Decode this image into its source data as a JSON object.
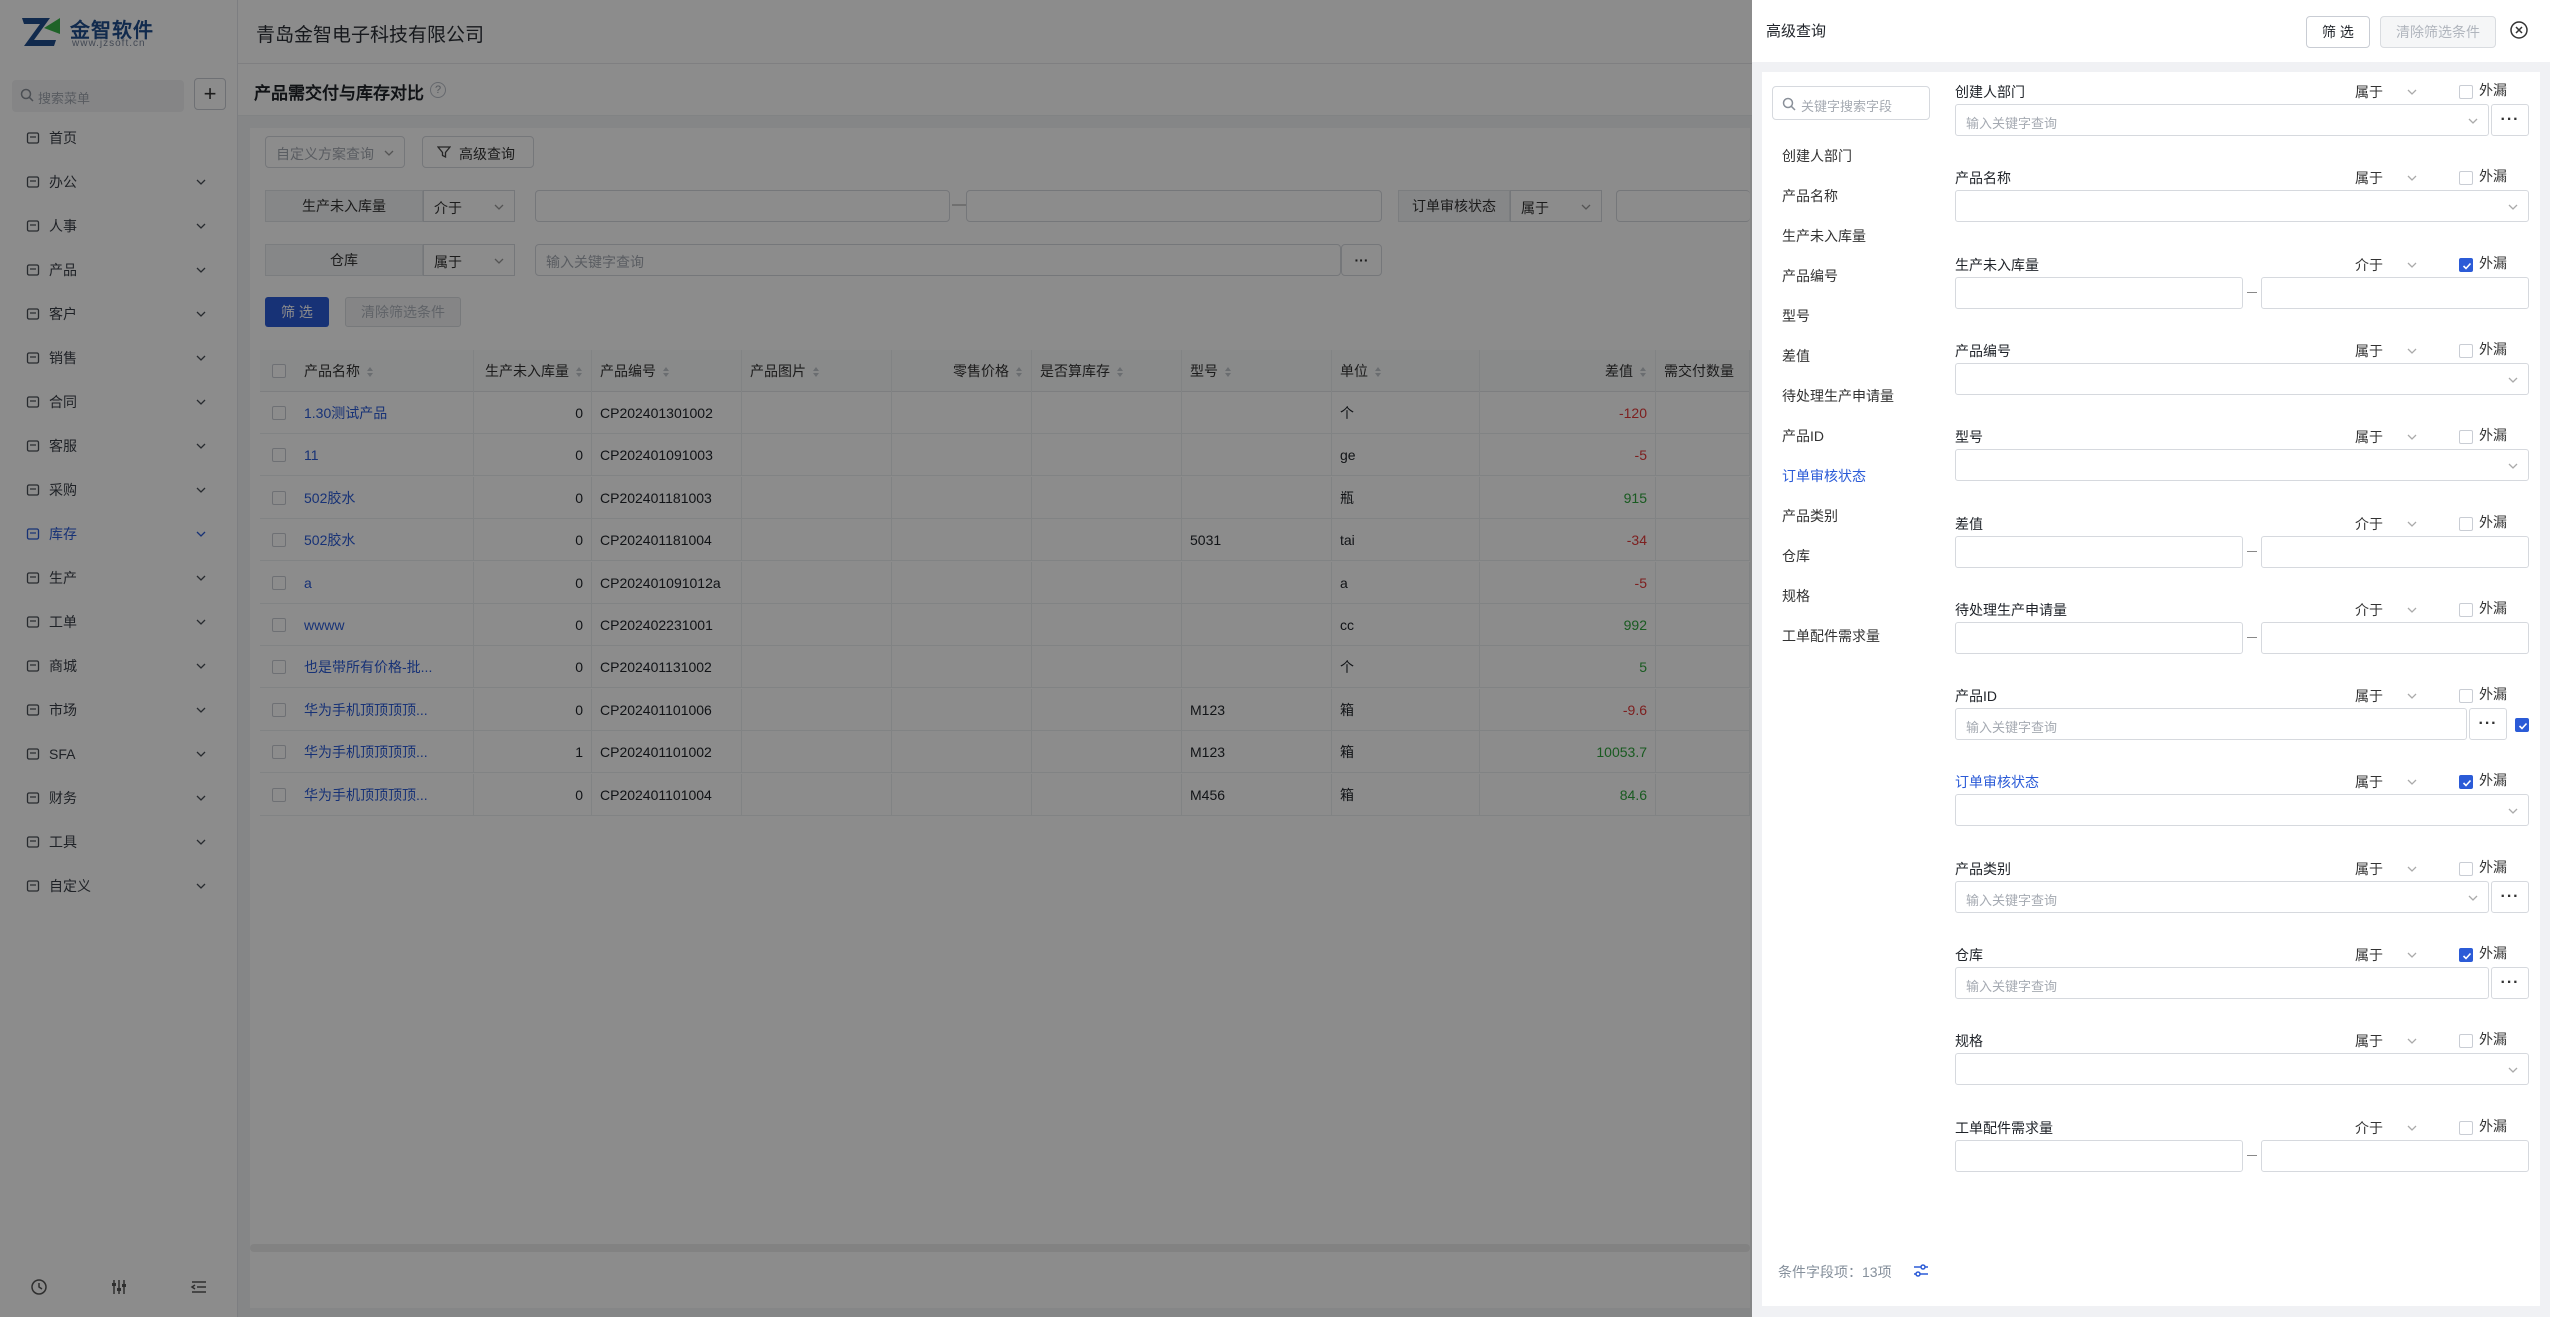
{
  "app": {
    "logo_name": "金智软件",
    "logo_url": "www.jzsoft.cn",
    "company": "青岛金智电子科技有限公司",
    "menu_search_placeholder": "搜索菜单"
  },
  "sidebar": {
    "items": [
      {
        "label": "首页",
        "icon": "home-icon",
        "expandable": false
      },
      {
        "label": "办公",
        "icon": "office-icon",
        "expandable": true
      },
      {
        "label": "人事",
        "icon": "people-icon",
        "expandable": true
      },
      {
        "label": "产品",
        "icon": "box-icon",
        "expandable": true
      },
      {
        "label": "客户",
        "icon": "chart-icon",
        "expandable": true
      },
      {
        "label": "销售",
        "icon": "target-icon",
        "expandable": true
      },
      {
        "label": "合同",
        "icon": "contract-icon",
        "expandable": true
      },
      {
        "label": "客服",
        "icon": "headset-icon",
        "expandable": true
      },
      {
        "label": "采购",
        "icon": "bag-icon",
        "expandable": true
      },
      {
        "label": "库存",
        "icon": "warehouse-icon",
        "expandable": true,
        "active": true
      },
      {
        "label": "生产",
        "icon": "factory-icon",
        "expandable": true
      },
      {
        "label": "工单",
        "icon": "ticket-icon",
        "expandable": true
      },
      {
        "label": "商城",
        "icon": "shop-icon",
        "expandable": true
      },
      {
        "label": "市场",
        "icon": "calendar-icon",
        "expandable": true
      },
      {
        "label": "SFA",
        "icon": "sfa-icon",
        "expandable": true
      },
      {
        "label": "财务",
        "icon": "bank-icon",
        "expandable": true
      },
      {
        "label": "工具",
        "icon": "toolbox-icon",
        "expandable": true
      },
      {
        "label": "自定义",
        "icon": "grid-icon",
        "expandable": true
      }
    ]
  },
  "page": {
    "title": "产品需交付与库存对比",
    "help": "?"
  },
  "filters": {
    "scheme_placeholder": "自定义方案查询",
    "advanced_label": "高级查询",
    "row1": {
      "label": "生产未入库量",
      "op": "介于",
      "label2": "订单审核状态",
      "op2": "属于"
    },
    "row2": {
      "label": "仓库",
      "op": "属于",
      "placeholder": "输入关键字查询"
    },
    "filter_btn": "筛 选",
    "clear_btn": "清除筛选条件",
    "range_sep": "—",
    "more_btn": "···"
  },
  "table": {
    "headers": [
      "产品名称",
      "生产未入库量",
      "产品编号",
      "产品图片",
      "零售价格",
      "是否算库存",
      "型号",
      "单位",
      "差值",
      "需交付数量"
    ],
    "rows": [
      {
        "name": "1.30测试产品",
        "qty": "0",
        "code": "CP202401301002",
        "img": "",
        "price": "",
        "stock": "",
        "model": "",
        "unit": "个",
        "diff": "-120"
      },
      {
        "name": "11",
        "qty": "0",
        "code": "CP202401091003",
        "img": "",
        "price": "",
        "stock": "",
        "model": "",
        "unit": "ge",
        "diff": "-5"
      },
      {
        "name": "502胶水",
        "qty": "0",
        "code": "CP202401181003",
        "img": "",
        "price": "",
        "stock": "",
        "model": "",
        "unit": "瓶",
        "diff": "915"
      },
      {
        "name": "502胶水",
        "qty": "0",
        "code": "CP202401181004",
        "img": "",
        "price": "",
        "stock": "",
        "model": "5031",
        "unit": "tai",
        "diff": "-34"
      },
      {
        "name": "a",
        "qty": "0",
        "code": "CP202401091012a",
        "img": "",
        "price": "",
        "stock": "",
        "model": "",
        "unit": "a",
        "diff": "-5"
      },
      {
        "name": "wwww",
        "qty": "0",
        "code": "CP202402231001",
        "img": "",
        "price": "",
        "stock": "",
        "model": "",
        "unit": "cc",
        "diff": "992"
      },
      {
        "name": "也是带所有价格-批...",
        "qty": "0",
        "code": "CP202401131002",
        "img": "",
        "price": "",
        "stock": "",
        "model": "",
        "unit": "个",
        "diff": "5"
      },
      {
        "name": "华为手机顶顶顶顶...",
        "qty": "0",
        "code": "CP202401101006",
        "img": "",
        "price": "",
        "stock": "",
        "model": "M123",
        "unit": "箱",
        "diff": "-9.6"
      },
      {
        "name": "华为手机顶顶顶顶...",
        "qty": "1",
        "code": "CP202401101002",
        "img": "",
        "price": "",
        "stock": "",
        "model": "M123",
        "unit": "箱",
        "diff": "10053.7"
      },
      {
        "name": "华为手机顶顶顶顶...",
        "qty": "0",
        "code": "CP202401101004",
        "img": "",
        "price": "",
        "stock": "",
        "model": "M456",
        "unit": "箱",
        "diff": "84.6"
      }
    ]
  },
  "drawer": {
    "title": "高级查询",
    "filter_btn": "筛 选",
    "clear_btn": "清除筛选条件",
    "field_search_placeholder": "关键字搜索字段",
    "field_list": [
      "创建人部门",
      "产品名称",
      "生产未入库量",
      "产品编号",
      "型号",
      "差值",
      "待处理生产申请量",
      "产品ID",
      "订单审核状态",
      "产品类别",
      "仓库",
      "规格",
      "工单配件需求量"
    ],
    "active_field": "订单审核状态",
    "count_text": "条件字段项：13项",
    "leak_label": "外漏",
    "fields": [
      {
        "label": "创建人部门",
        "op": "属于",
        "input": "select-dots",
        "placeholder": "输入关键字查询",
        "leak": false
      },
      {
        "label": "产品名称",
        "op": "属于",
        "input": "select",
        "placeholder": "",
        "leak": false
      },
      {
        "label": "生产未入库量",
        "op": "介于",
        "input": "range",
        "placeholder": "",
        "leak": true
      },
      {
        "label": "产品编号",
        "op": "属于",
        "input": "select",
        "placeholder": "",
        "leak": false
      },
      {
        "label": "型号",
        "op": "属于",
        "input": "select",
        "placeholder": "",
        "leak": false
      },
      {
        "label": "差值",
        "op": "介于",
        "input": "range",
        "placeholder": "",
        "leak": false
      },
      {
        "label": "待处理生产申请量",
        "op": "介于",
        "input": "range",
        "placeholder": "",
        "leak": false
      },
      {
        "label": "产品ID",
        "op": "属于",
        "input": "text-dots-check",
        "placeholder": "输入关键字查询",
        "leak": false
      },
      {
        "label": "订单审核状态",
        "op": "属于",
        "input": "select",
        "placeholder": "",
        "leak": true,
        "highlight": true
      },
      {
        "label": "产品类别",
        "op": "属于",
        "input": "select-dots",
        "placeholder": "输入关键字查询",
        "leak": false
      },
      {
        "label": "仓库",
        "op": "属于",
        "input": "text-dots",
        "placeholder": "输入关键字查询",
        "leak": true
      },
      {
        "label": "规格",
        "op": "属于",
        "input": "select",
        "placeholder": "",
        "leak": false
      },
      {
        "label": "工单配件需求量",
        "op": "介于",
        "input": "range",
        "placeholder": "",
        "leak": false
      }
    ]
  },
  "colors": {
    "primary": "#2b5bd7",
    "negative": "#e33a3a",
    "positive": "#2fa53c",
    "overlay": "rgba(0,0,0,0.45)"
  }
}
